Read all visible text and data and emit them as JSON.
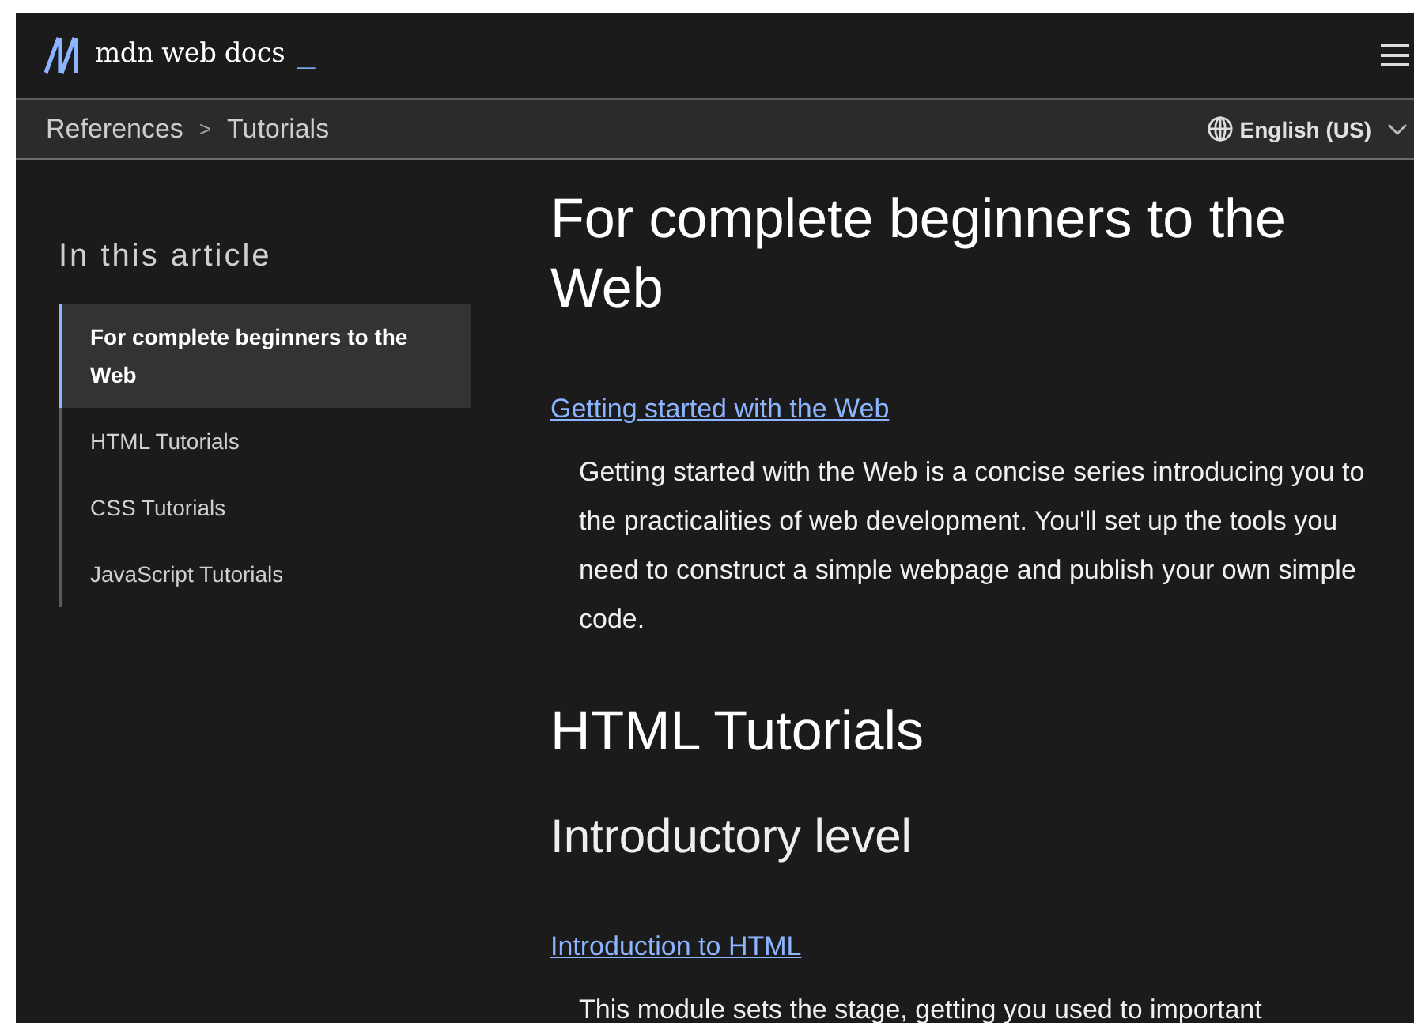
{
  "header": {
    "logo_text": "mdn web docs",
    "logo_cursor": "_"
  },
  "breadcrumbs": {
    "items": [
      "References",
      "Tutorials"
    ],
    "separator": ">"
  },
  "language": {
    "label": "English (US)"
  },
  "toc": {
    "title": "In this article",
    "items": [
      {
        "label": "For complete beginners to the Web",
        "selected": true
      },
      {
        "label": "HTML Tutorials",
        "selected": false
      },
      {
        "label": "CSS Tutorials",
        "selected": false
      },
      {
        "label": "JavaScript Tutorials",
        "selected": false
      }
    ]
  },
  "content": [
    {
      "kind": "h1",
      "text": "For complete beginners to the Web"
    },
    {
      "kind": "link",
      "text": "Getting started with the Web"
    },
    {
      "kind": "desc",
      "text": "Getting started with the Web is a concise series introducing you to the practicalities of web development. You'll set up the tools you need to construct a simple webpage and publish your own simple code."
    },
    {
      "kind": "h2",
      "text": "HTML Tutorials"
    },
    {
      "kind": "h3",
      "text": "Introductory level"
    },
    {
      "kind": "link",
      "text": "Introduction to HTML"
    },
    {
      "kind": "desc",
      "text": "This module sets the stage, getting you used to important"
    }
  ]
}
